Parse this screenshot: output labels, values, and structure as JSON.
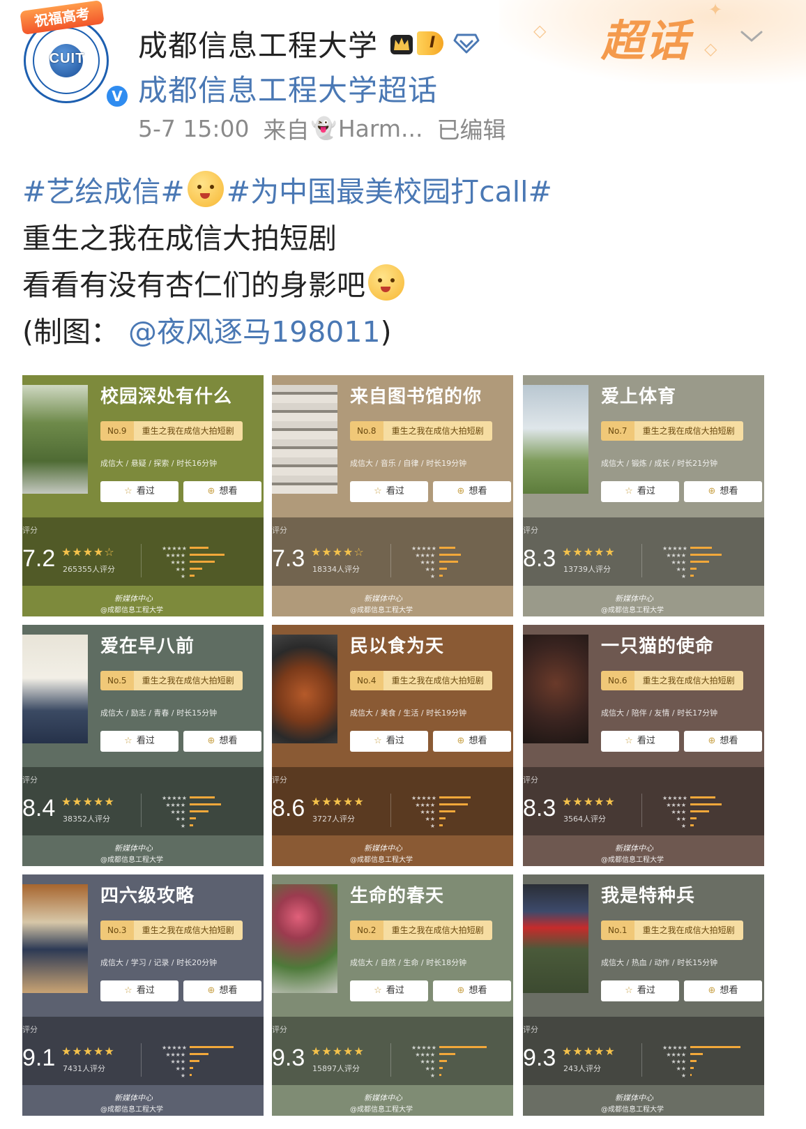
{
  "header": {
    "banner_tag": "祝福高考",
    "avatar_text": "CUIT",
    "account_name": "成都信息工程大学",
    "level_badge": "I",
    "super_topic_title": "成都信息工程大学超话",
    "timestamp": "5-7 15:00",
    "source_prefix": "来自",
    "source_device": "Harm...",
    "edited": "已编辑",
    "super_logo": "超话",
    "verified_mark": "V",
    "colors": {
      "link": "#4a78b4",
      "meta": "#8a8a8a",
      "accent": "#f49a4c"
    }
  },
  "post": {
    "topic1": "#艺绘成信#",
    "topic2": "#为中国最美校园打call#",
    "line1": "重生之我在成信大拍短剧",
    "line2": "看看有没有杏仁们的身影吧",
    "credit_prefix": "(制图：",
    "mention": "@夜风逐马198011",
    "credit_suffix": ")"
  },
  "cards": [
    {
      "title": "校园深处有什么",
      "no": "No.9",
      "label": "重生之我在成信大拍短剧",
      "genre": "成信大 / 悬疑 / 探索 / 时长16分钟",
      "seen": "看过",
      "want": "想看",
      "rate_label": "评分",
      "score": "7.2",
      "stars": "★★★★☆",
      "count": "265355人评分",
      "watermark": "@成都信息工程大学",
      "wm_top": "新媒体中心",
      "bg": "#7d8a3c",
      "photo": "ph-bamboo",
      "bars": [
        0.3,
        0.55,
        0.4,
        0.2,
        0.08
      ]
    },
    {
      "title": "来自图书馆的你",
      "no": "No.8",
      "label": "重生之我在成信大拍短剧",
      "genre": "成信大 / 音乐 / 自律 / 时长19分钟",
      "seen": "看过",
      "want": "想看",
      "rate_label": "评分",
      "score": "7.3",
      "stars": "★★★★☆",
      "count": "18334人评分",
      "watermark": "@成都信息工程大学",
      "wm_top": "新媒体中心",
      "bg": "#b09a7a",
      "photo": "ph-library",
      "bars": [
        0.25,
        0.35,
        0.3,
        0.12,
        0.06
      ]
    },
    {
      "title": "爱上体育",
      "no": "No.7",
      "label": "重生之我在成信大拍短剧",
      "genre": "成信大 / 锻炼 / 成长 / 时长21分钟",
      "seen": "看过",
      "want": "想看",
      "rate_label": "评分",
      "score": "8.3",
      "stars": "★★★★★",
      "count": "13739人评分",
      "watermark": "@成都信息工程大学",
      "wm_top": "新媒体中心",
      "bg": "#9a9a8a",
      "photo": "ph-sport",
      "bars": [
        0.35,
        0.5,
        0.3,
        0.1,
        0.05
      ]
    },
    {
      "title": "爱在早八前",
      "no": "No.5",
      "label": "重生之我在成信大拍短剧",
      "genre": "成信大 / 励志 / 青春 / 时长15分钟",
      "seen": "看过",
      "want": "想看",
      "rate_label": "评分",
      "score": "8.4",
      "stars": "★★★★★",
      "count": "38352人评分",
      "watermark": "@成都信息工程大学",
      "wm_top": "新媒体中心",
      "bg": "#5f6d62",
      "photo": "ph-class",
      "bars": [
        0.4,
        0.5,
        0.3,
        0.1,
        0.05
      ]
    },
    {
      "title": "民以食为天",
      "no": "No.4",
      "label": "重生之我在成信大拍短剧",
      "genre": "成信大 / 美食 / 生活 / 时长19分钟",
      "seen": "看过",
      "want": "想看",
      "rate_label": "评分",
      "score": "8.6",
      "stars": "★★★★★",
      "count": "3727人评分",
      "watermark": "@成都信息工程大学",
      "wm_top": "新媒体中心",
      "bg": "#8a5a34",
      "photo": "ph-food",
      "bars": [
        0.5,
        0.45,
        0.25,
        0.1,
        0.05
      ]
    },
    {
      "title": "一只猫的使命",
      "no": "No.6",
      "label": "重生之我在成信大拍短剧",
      "genre": "成信大 / 陪伴 / 友情 / 时长17分钟",
      "seen": "看过",
      "want": "想看",
      "rate_label": "评分",
      "score": "8.3",
      "stars": "★★★★★",
      "count": "3564人评分",
      "watermark": "@成都信息工程大学",
      "wm_top": "新媒体中心",
      "bg": "#6e5850",
      "photo": "ph-cat",
      "bars": [
        0.4,
        0.5,
        0.3,
        0.1,
        0.05
      ]
    },
    {
      "title": "四六级攻略",
      "no": "No.3",
      "label": "重生之我在成信大拍短剧",
      "genre": "成信大 / 学习 / 记录 / 时长20分钟",
      "seen": "看过",
      "want": "想看",
      "rate_label": "评分",
      "score": "9.1",
      "stars": "★★★★★",
      "count": "7431人评分",
      "watermark": "@成都信息工程大学",
      "wm_top": "新媒体中心",
      "bg": "#5c6170",
      "photo": "ph-study",
      "bars": [
        0.7,
        0.3,
        0.15,
        0.06,
        0.03
      ]
    },
    {
      "title": "生命的春天",
      "no": "No.2",
      "label": "重生之我在成信大拍短剧",
      "genre": "成信大 / 自然 / 生命 / 时长18分钟",
      "seen": "看过",
      "want": "想看",
      "rate_label": "评分",
      "score": "9.3",
      "stars": "★★★★★",
      "count": "15897人评分",
      "watermark": "@成都信息工程大学",
      "wm_top": "新媒体中心",
      "bg": "#7f8c74",
      "photo": "ph-flower",
      "bars": [
        0.75,
        0.25,
        0.12,
        0.05,
        0.03
      ]
    },
    {
      "title": "我是特种兵",
      "no": "No.1",
      "label": "重生之我在成信大拍短剧",
      "genre": "成信大 / 热血 / 动作 / 时长15分钟",
      "seen": "看过",
      "want": "想看",
      "rate_label": "评分",
      "score": "9.3",
      "stars": "★★★★★",
      "count": "243人评分",
      "watermark": "@成都信息工程大学",
      "wm_top": "新媒体中心",
      "bg": "#6a6e64",
      "photo": "ph-army",
      "bars": [
        0.8,
        0.2,
        0.1,
        0.05,
        0.02
      ]
    }
  ]
}
